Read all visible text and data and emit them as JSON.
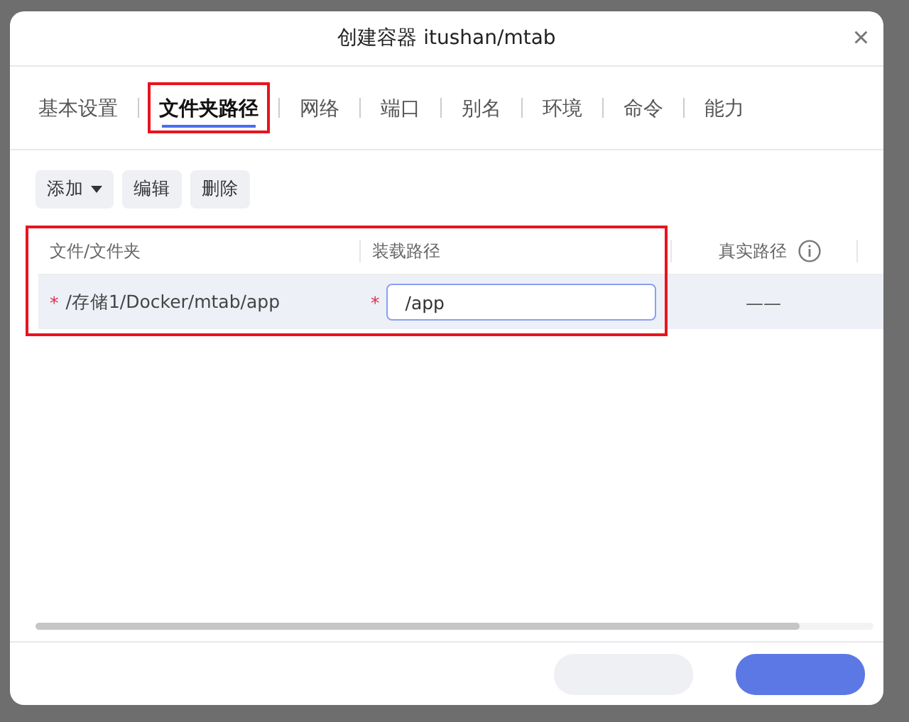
{
  "dialog": {
    "title": "创建容器 itushan/mtab",
    "close": "×"
  },
  "tabs": [
    {
      "label": "基本设置",
      "selected": false,
      "highlighted": false
    },
    {
      "label": "文件夹路径",
      "selected": true,
      "highlighted": true
    },
    {
      "label": "网络",
      "selected": false,
      "highlighted": false
    },
    {
      "label": "端口",
      "selected": false,
      "highlighted": false
    },
    {
      "label": "别名",
      "selected": false,
      "highlighted": false
    },
    {
      "label": "环境",
      "selected": false,
      "highlighted": false
    },
    {
      "label": "命令",
      "selected": false,
      "highlighted": false
    },
    {
      "label": "能力",
      "selected": false,
      "highlighted": false
    }
  ],
  "toolbar": [
    {
      "label": "添加",
      "kind": "dropdown"
    },
    {
      "label": "编辑",
      "kind": "plain"
    },
    {
      "label": "删除",
      "kind": "plain"
    }
  ],
  "table": {
    "highlighted": true,
    "columns": [
      {
        "label": "文件/文件夹",
        "info": false
      },
      {
        "label": "装载路径",
        "info": false
      },
      {
        "label": "真实路径",
        "info": true
      }
    ],
    "rows": [
      {
        "file": "/存储1/Docker/mtab/app",
        "file_mark": "*",
        "mount": "/app",
        "mount_mark": "*",
        "real": "——",
        "selected": true
      }
    ]
  },
  "footer": {
    "buttons": [
      {
        "kind": "secondary"
      },
      {
        "kind": "primary"
      }
    ]
  }
}
